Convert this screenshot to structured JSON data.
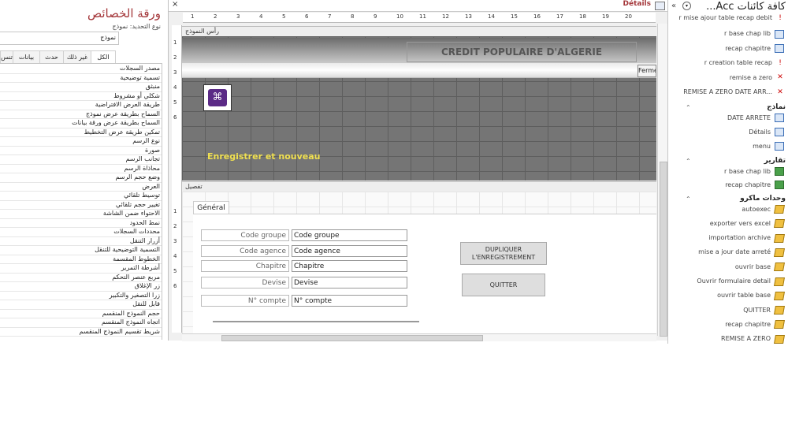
{
  "property_sheet": {
    "title": "ورقة الخصائص",
    "selection_type": "نوع التحديد:  نموذج",
    "object_combo": "نموذج",
    "tabs": [
      "الكل",
      "غير ذلك",
      "حدث",
      "بيانات",
      "تنس"
    ],
    "properties": [
      "مصدر السجلات",
      "تسمية توضيحية",
      "منبثق",
      "شكلي أو مشروط",
      "طريقة العرض الافتراضية",
      "السماح بطريقة عرض نموذج",
      "السماح بطريقة عرض ورقة بيانات",
      "تمكين طريقة عرض التخطيط",
      "نوع الرسم",
      "صورة",
      "تجانب الرسم",
      "محاذاة الرسم",
      "وضع حجم الرسم",
      "العرض",
      "توسيط تلقائي",
      "تغيير حجم تلقائي",
      "الاحتواء ضمن الشاشة",
      "نمط الحدود",
      "محددات السجلات",
      "أزرار التنقل",
      "التسمية التوضيحية للتنقل",
      "الخطوط المقسمة",
      "أشرطة التمرير",
      "مربع عنصر التحكم",
      "زر الإغلاق",
      "زرا التصغير والتكبير",
      "قابل للنقل",
      "حجم النموذج المنقسم",
      "اتجاه النموذج المنقسم",
      "شريط تقسيم النموذج المنقسم"
    ]
  },
  "design": {
    "close_glyph": "×",
    "doc_tab": "Détails",
    "ruler_numbers": [
      "1",
      "2",
      "3",
      "4",
      "5",
      "6",
      "7",
      "8",
      "9",
      "10",
      "11",
      "12",
      "13",
      "14",
      "15",
      "16",
      "17",
      "18",
      "19",
      "20"
    ],
    "vruler_numbers": [
      "1",
      "2",
      "3",
      "4",
      "5",
      "6",
      "1",
      "2",
      "3",
      "4",
      "5",
      "6"
    ],
    "header_section": "رأس النموذج",
    "detail_section": "تفصيل",
    "banner_title": "CREDIT POPULAIRE D'ALGERIE",
    "close_button": "Fermer",
    "save_new_label": "Enregistrer et nouveau",
    "tab_general": "Général",
    "fields": [
      {
        "label": "Code groupe",
        "value": "Code groupe"
      },
      {
        "label": "Code agence",
        "value": "Code agence"
      },
      {
        "label": "Chapitre",
        "value": "Chapitre"
      },
      {
        "label": "Devise",
        "value": "Devise"
      },
      {
        "label": "N° compte",
        "value": "N° compte"
      }
    ],
    "btn_duplicate": "DUPLIQUER L'ENREGISTREMENT",
    "btn_quit": "QUITTER"
  },
  "nav_pane": {
    "title": "كافة كائنات Acc...",
    "items_top": [
      {
        "label": "r mise ajour table recap debit",
        "icon": "query-icon"
      },
      {
        "label": "r base chap lib",
        "icon": "form-icon"
      },
      {
        "label": "recap chapitre",
        "icon": "form-icon"
      },
      {
        "label": "r creation table recap",
        "icon": "query-icon"
      },
      {
        "label": "remise a zero",
        "icon": "delete-query-icon"
      },
      {
        "label": "REMISE A ZERO DATE ARR...",
        "icon": "delete-query-icon"
      }
    ],
    "group_forms": "نماذج",
    "forms": [
      {
        "label": "DATE ARRETE",
        "icon": "form-icon"
      },
      {
        "label": "Détails",
        "icon": "form-icon"
      },
      {
        "label": "menu",
        "icon": "form-icon"
      }
    ],
    "group_reports": "تقارير",
    "reports": [
      {
        "label": "r base chap lib",
        "icon": "report-icon"
      },
      {
        "label": "recap chapitre",
        "icon": "report-icon"
      }
    ],
    "group_macros": "وحدات ماكرو",
    "macros": [
      {
        "label": "autoexec",
        "icon": "macro-icon"
      },
      {
        "label": "exporter vers excel",
        "icon": "macro-icon"
      },
      {
        "label": "importation archive",
        "icon": "macro-icon"
      },
      {
        "label": "mise a jour date arreté",
        "icon": "macro-icon"
      },
      {
        "label": "ouvrir base",
        "icon": "macro-icon"
      },
      {
        "label": "Ouvrir formulaire detail",
        "icon": "macro-icon"
      },
      {
        "label": "ouvrir table base",
        "icon": "macro-icon"
      },
      {
        "label": "QUITTER",
        "icon": "macro-icon"
      },
      {
        "label": "recap chapitre",
        "icon": "macro-icon"
      },
      {
        "label": "REMISE A ZERO",
        "icon": "macro-icon"
      }
    ]
  }
}
